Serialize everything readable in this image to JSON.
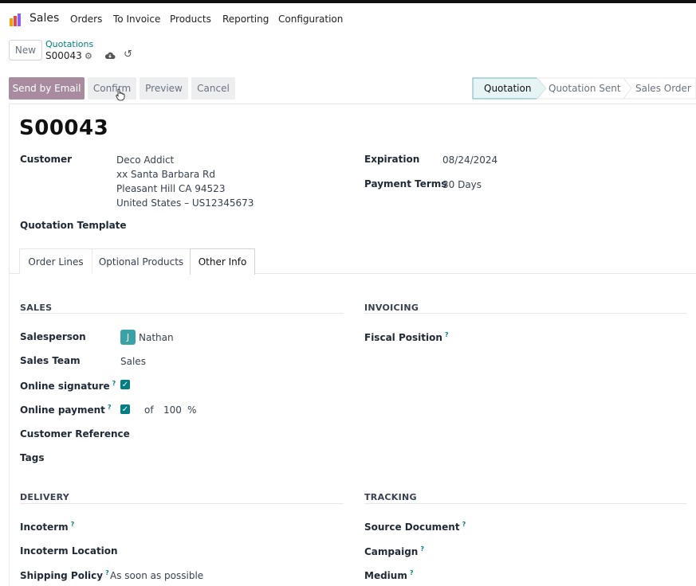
{
  "app": {
    "name": "Sales"
  },
  "menu": [
    "Orders",
    "To Invoice",
    "Products",
    "Reporting",
    "Configuration"
  ],
  "breadcrumb": {
    "parent": "Quotations",
    "current": "S00043",
    "new_label": "New"
  },
  "actions": {
    "send_email": "Send by Email",
    "confirm": "Confirm",
    "preview": "Preview",
    "cancel": "Cancel"
  },
  "status": [
    "Quotation",
    "Quotation Sent",
    "Sales Order"
  ],
  "status_active": "Quotation",
  "record": {
    "title": "S00043",
    "customer_label": "Customer",
    "customer_name": "Deco Addict",
    "address1": "xx Santa Barbara Rd",
    "address2": "Pleasant Hill CA 94523",
    "address3": "United States – US12345673",
    "expiration_label": "Expiration",
    "expiration": "08/24/2024",
    "payment_terms_label": "Payment Terms",
    "payment_terms": "30 Days",
    "template_label": "Quotation Template"
  },
  "tabs": [
    "Order Lines",
    "Optional Products",
    "Other Info"
  ],
  "active_tab": "Other Info",
  "sales": {
    "heading": "SALES",
    "salesperson_label": "Salesperson",
    "salesperson_initial": "J",
    "salesperson": "Nathan",
    "team_label": "Sales Team",
    "team": "Sales",
    "online_signature_label": "Online signature",
    "online_payment_label": "Online payment",
    "of": "of",
    "percent_value": "100",
    "percent_sign": "%",
    "customer_ref_label": "Customer Reference",
    "tags_label": "Tags"
  },
  "invoicing": {
    "heading": "INVOICING",
    "fiscal_label": "Fiscal Position"
  },
  "delivery": {
    "heading": "DELIVERY",
    "incoterm_label": "Incoterm",
    "incoterm_location_label": "Incoterm Location",
    "shipping_policy_label": "Shipping Policy",
    "shipping_policy": "As soon as possible"
  },
  "tracking": {
    "heading": "TRACKING",
    "source_label": "Source Document",
    "campaign_label": "Campaign",
    "medium_label": "Medium"
  },
  "colors": {
    "accent": "#017e84",
    "primary_btn": "#a98b9f"
  }
}
